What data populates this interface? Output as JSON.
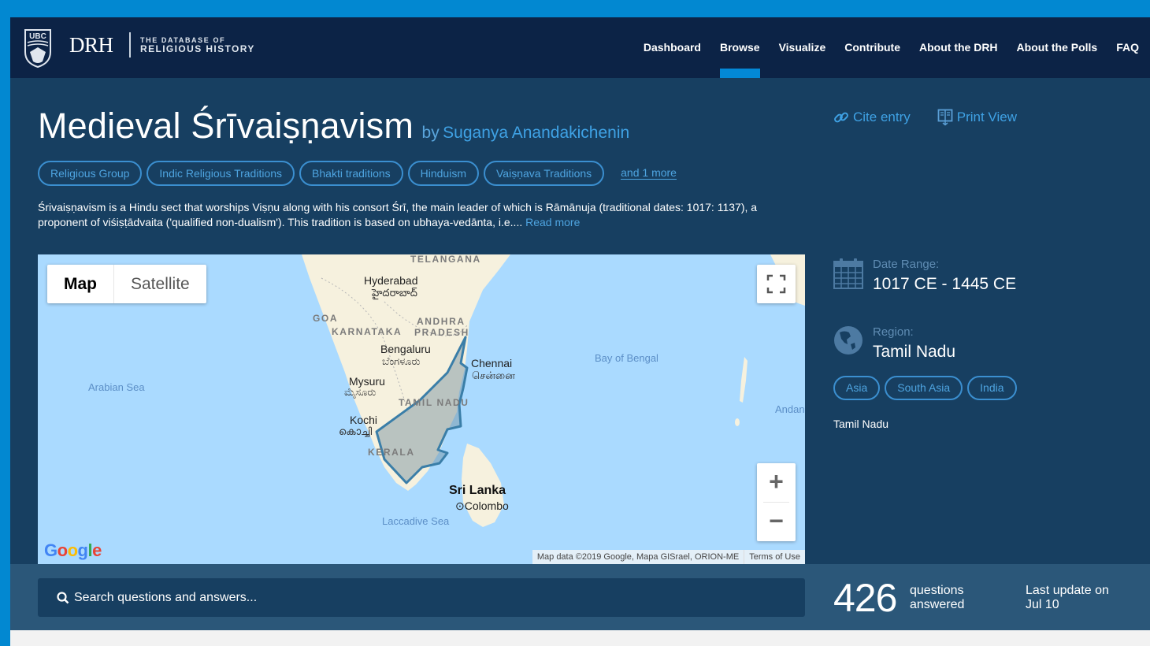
{
  "header": {
    "logo_short": "DRH",
    "logo_sub_line1": "THE DATABASE OF",
    "logo_sub_line2": "RELIGIOUS HISTORY",
    "shield_text": "UBC",
    "nav": [
      {
        "label": "Dashboard",
        "active": false
      },
      {
        "label": "Browse",
        "active": true
      },
      {
        "label": "Visualize",
        "active": false
      },
      {
        "label": "Contribute",
        "active": false
      },
      {
        "label": "About the DRH",
        "active": false
      },
      {
        "label": "About the Polls",
        "active": false
      },
      {
        "label": "FAQ",
        "active": false
      }
    ]
  },
  "entry": {
    "title": "Medieval Śrīvaiṣṇavism",
    "by": "by",
    "author": "Suganya Anandakichenin",
    "tags": [
      "Religious Group",
      "Indic Religious Traditions",
      "Bhakti traditions",
      "Hinduism",
      "Vaiṣṇava Traditions"
    ],
    "more_tags": "and 1 more",
    "description": "Śrivaiṣṇavism is a Hindu sect that worships Viṣṇu along with his consort Śrī, the main leader of which is Rāmānuja (traditional dates: 1017: 1137), a proponent of viśiṣṭādvaita ('qualified non-dualism'). This tradition is based on ubhaya-vedānta, i.e....",
    "read_more": "Read more"
  },
  "actions": {
    "cite": "Cite entry",
    "print": "Print View"
  },
  "meta": {
    "date_label": "Date Range:",
    "date_value": "1017 CE - 1445 CE",
    "region_label": "Region:",
    "region_value": "Tamil Nadu",
    "region_tags": [
      "Asia",
      "South Asia",
      "India"
    ],
    "region_name": "Tamil Nadu"
  },
  "map": {
    "type_buttons": [
      "Map",
      "Satellite"
    ],
    "selected_type": "Map",
    "zoom_in": "+",
    "zoom_out": "−",
    "labels": {
      "arabian_sea": "Arabian Sea",
      "bay_of_bengal": "Bay of Bengal",
      "laccadive_sea": "Laccadive Sea",
      "andaman": "Andan",
      "telangana": "TELANGANA",
      "goa": "GOA",
      "karnataka": "KARNATAKA",
      "andhra1": "ANDHRA",
      "andhra2": "PRADESH",
      "tamil_nadu": "TAMIL NADU",
      "kerala": "KERALA",
      "hyderabad": "Hyderabad",
      "hyderabad_te": "హైదరాబాద్",
      "bengaluru": "Bengaluru",
      "bengaluru_kn": "ಬೆಂಗಳೂರು",
      "mysuru": "Mysuru",
      "mysuru_kn": "ಮೈಸೂರು",
      "chennai": "Chennai",
      "chennai_ta": "சென்னை",
      "kochi": "Kochi",
      "kochi_ml": "കൊച്ചി",
      "sri_lanka": "Sri Lanka",
      "colombo": "Colombo"
    },
    "google": "Google",
    "attribution": "Map data ©2019 Google, Mapa GISrael, ORION-ME",
    "terms": "Terms of Use"
  },
  "bottom": {
    "search_placeholder": "Search questions and answers...",
    "count": "426",
    "count_label_1": "questions",
    "count_label_2": "answered",
    "update_line1": "Last update on",
    "update_line2": "Jul 10"
  },
  "colors": {
    "accent": "#0388d6",
    "link": "#3fa2e5",
    "header_bg": "#0c2346",
    "page_bg": "#173f61",
    "polygon_stroke": "#3a7ea8"
  }
}
